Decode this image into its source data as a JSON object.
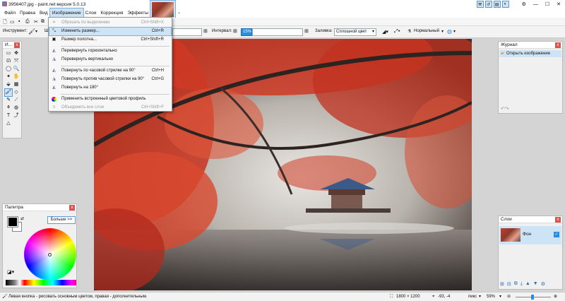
{
  "window": {
    "title": "3956407.jpg - paint.net версия 5.0.13",
    "controls": [
      "—",
      "☐",
      "✕"
    ]
  },
  "menubar": {
    "items": [
      "Файл",
      "Правка",
      "Вид",
      "Изображение",
      "Слои",
      "Коррекция",
      "Эффекты"
    ],
    "active_index": 3
  },
  "toolbar": {
    "instrument_label": "Инструмент:",
    "interval_label": "Интервал:",
    "interval_value": "15%",
    "fill_label": "Заливка:",
    "fill_value": "Сплошной цвет",
    "blend_value": "Нормальный",
    "tool_short": "Ш"
  },
  "image_menu": {
    "items": [
      {
        "label": "Обрезать по выделению",
        "shortcut": "Ctrl+Shift+X",
        "disabled": true,
        "icon": "crop-icon"
      },
      {
        "label": "Изменить размер...",
        "shortcut": "Ctrl+R",
        "highlighted": true,
        "icon": "resize-icon"
      },
      {
        "label": "Размер полотна...",
        "shortcut": "Ctrl+Shift+R",
        "icon": "canvas-size-icon"
      },
      {
        "label": "Перевернуть горизонтально",
        "shortcut": "",
        "icon": "flip-horizontal-icon"
      },
      {
        "label": "Перевернуть вертикально",
        "shortcut": "",
        "icon": "flip-vertical-icon"
      },
      {
        "label": "Повернуть по часовой стрелке на 90°",
        "shortcut": "Ctrl+H",
        "icon": "rotate-cw-icon"
      },
      {
        "label": "Повернуть против часовой стрелки на 90°",
        "shortcut": "Ctrl+G",
        "icon": "rotate-ccw-icon"
      },
      {
        "label": "Повернуть на 180°",
        "shortcut": "",
        "icon": "rotate-180-icon"
      },
      {
        "label": "Применить встроенный цветовой профиль",
        "shortcut": "",
        "icon": "color-profile-icon"
      },
      {
        "label": "Объединить все слои",
        "shortcut": "Ctrl+Shift+F",
        "disabled": true,
        "icon": "flatten-icon"
      }
    ]
  },
  "tools_panel": {
    "title": "И..."
  },
  "palette_panel": {
    "title": "Палитра",
    "more_button": "Больше >>"
  },
  "history_panel": {
    "title": "Журнал",
    "items": [
      "Открыть изображение"
    ]
  },
  "layers_panel": {
    "title": "Слои",
    "layers": [
      {
        "name": "Фон",
        "visible": true
      }
    ]
  },
  "status": {
    "hint": "Левая кнопка - рисовать основным цветом, правая - дополнительным.",
    "image_size": "1800 × 1200",
    "cursor": "-93, -4",
    "units": "пикс",
    "zoom": "59%"
  },
  "colors": {
    "accent": "#2a8de0",
    "menu_highlight": "#cde4f7",
    "close_red": "#d9534f"
  }
}
